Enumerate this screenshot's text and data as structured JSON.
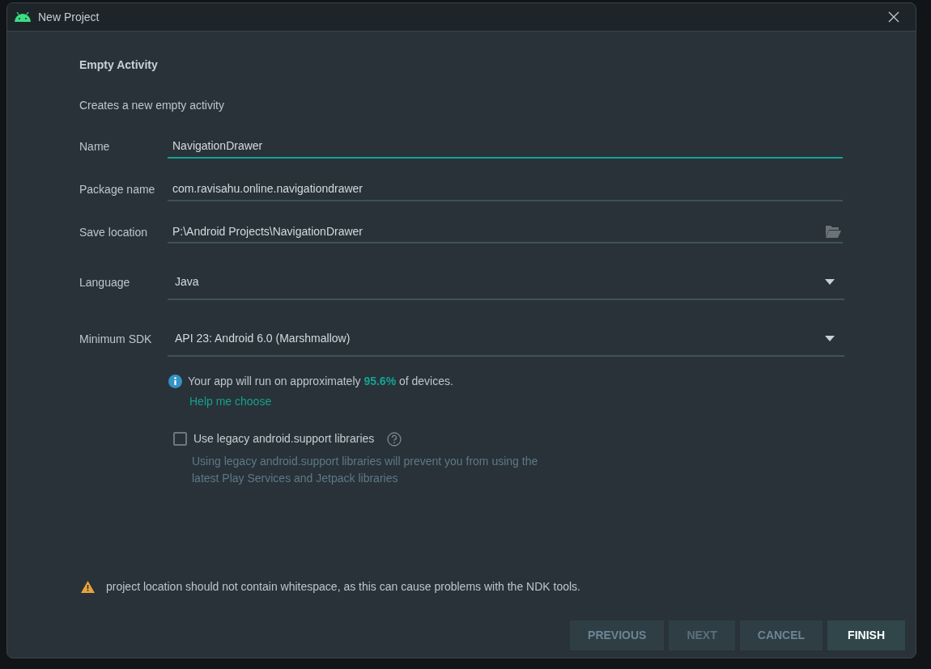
{
  "window": {
    "title": "New Project"
  },
  "heading": "Empty Activity",
  "description": "Creates a new empty activity",
  "fields": [
    {
      "label": "Name",
      "kind": "text",
      "value": "NavigationDrawer",
      "focused": true
    },
    {
      "label": "Package name",
      "kind": "text",
      "value": "com.ravisahu.online.navigationdrawer",
      "focused": false
    },
    {
      "label": "Save location",
      "kind": "path",
      "value": "P:\\Android Projects\\NavigationDrawer",
      "focused": false
    },
    {
      "label": "Language",
      "kind": "dropdown",
      "value": "Java",
      "focused": false
    },
    {
      "label": "Minimum SDK",
      "kind": "dropdown",
      "value": "API 23: Android 6.0 (Marshmallow)",
      "focused": false
    }
  ],
  "info": {
    "text": "Your app will run on approximately **95.6%** of devices.",
    "link": "Help me choose"
  },
  "legacy": {
    "label": "Use legacy android.support libraries",
    "checked": false,
    "note": "Using legacy android.support libraries will prevent you from using the latest Play Services and Jetpack libraries"
  },
  "warning": "project location should not contain whitespace, as this can cause problems with the NDK tools.",
  "buttons": [
    {
      "label": "PREVIOUS",
      "disabled": false,
      "primary": false
    },
    {
      "label": "NEXT",
      "disabled": true,
      "primary": false
    },
    {
      "label": "CANCEL",
      "disabled": false,
      "primary": false
    },
    {
      "label": "FINISH",
      "disabled": false,
      "primary": true
    }
  ]
}
